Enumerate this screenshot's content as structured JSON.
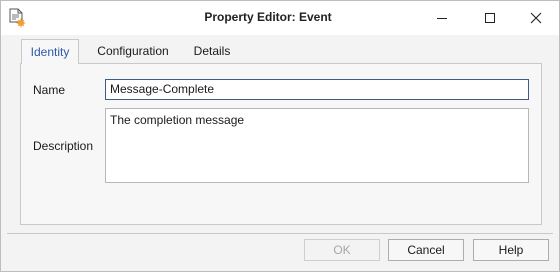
{
  "window": {
    "title": "Property Editor:  Event",
    "icons": {
      "app": "document-properties-icon",
      "minimize": "minimize-icon",
      "maximize": "maximize-icon",
      "close": "close-icon"
    }
  },
  "tabs": [
    {
      "label": "Identity",
      "active": true
    },
    {
      "label": "Configuration",
      "active": false
    },
    {
      "label": "Details",
      "active": false
    }
  ],
  "form": {
    "name_label": "Name",
    "name_value": "Message-Complete",
    "description_label": "Description",
    "description_value": "The completion message"
  },
  "buttons": {
    "ok": {
      "label": "OK",
      "enabled": false
    },
    "cancel": {
      "label": "Cancel",
      "enabled": true
    },
    "help": {
      "label": "Help",
      "enabled": true
    }
  },
  "colors": {
    "accent": "#2c57a8",
    "focus_border": "#3c5a8a",
    "icon_orange": "#f0a030"
  }
}
